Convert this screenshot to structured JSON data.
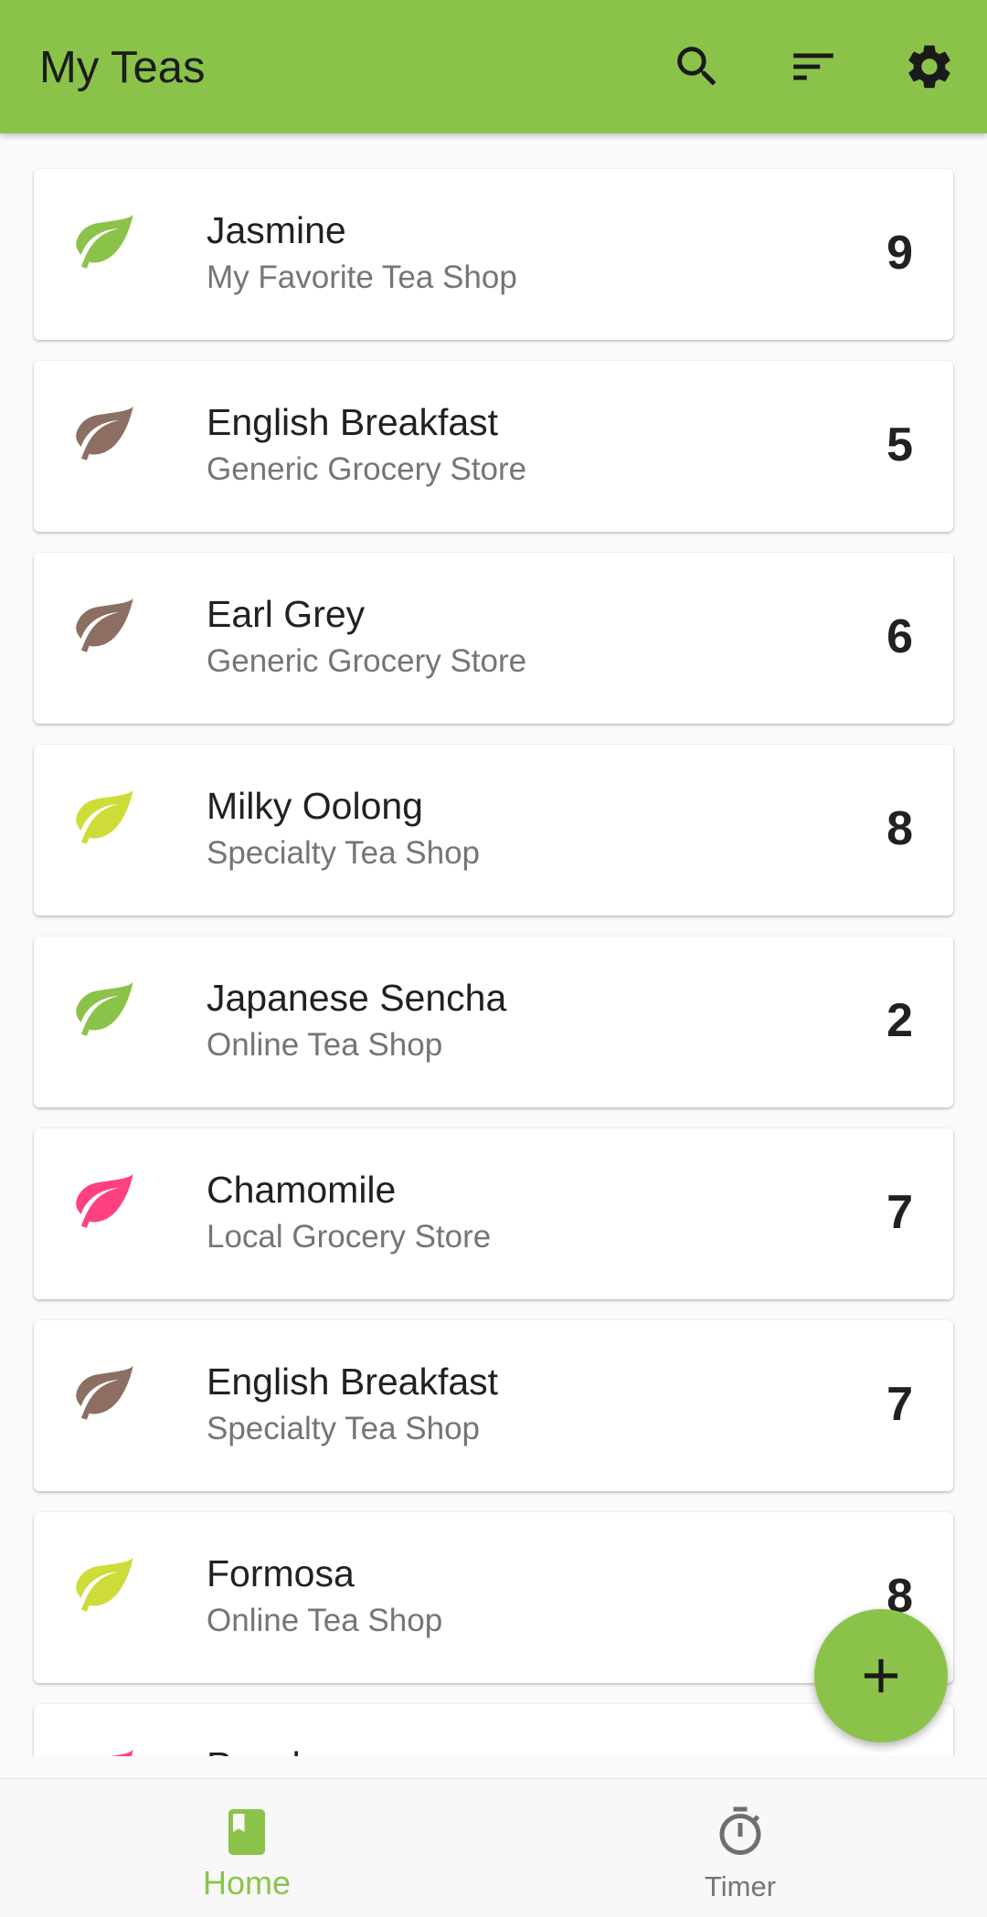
{
  "app": {
    "title": "My Teas",
    "accent_color": "#8bc34a"
  },
  "toolbar": {
    "search_icon": "search-icon",
    "sort_icon": "sort-icon",
    "settings_icon": "gear-icon"
  },
  "teas": [
    {
      "name": "Jasmine",
      "shop": "My Favorite Tea Shop",
      "rating": "9",
      "leaf_color": "#8bc34a"
    },
    {
      "name": "English Breakfast",
      "shop": "Generic Grocery Store",
      "rating": "5",
      "leaf_color": "#8d6e63"
    },
    {
      "name": "Earl Grey",
      "shop": "Generic Grocery Store",
      "rating": "6",
      "leaf_color": "#8d6e63"
    },
    {
      "name": "Milky Oolong",
      "shop": "Specialty Tea Shop",
      "rating": "8",
      "leaf_color": "#cddc39"
    },
    {
      "name": "Japanese Sencha",
      "shop": "Online Tea Shop",
      "rating": "2",
      "leaf_color": "#8bc34a"
    },
    {
      "name": "Chamomile",
      "shop": "Local Grocery Store",
      "rating": "7",
      "leaf_color": "#ff4081"
    },
    {
      "name": "English Breakfast",
      "shop": "Specialty Tea Shop",
      "rating": "7",
      "leaf_color": "#8d6e63"
    },
    {
      "name": "Formosa",
      "shop": "Online Tea Shop",
      "rating": "8",
      "leaf_color": "#cddc39"
    },
    {
      "name": "Peach",
      "shop": "",
      "rating": "",
      "leaf_color": "#ff4081"
    }
  ],
  "fab": {
    "icon": "plus-icon",
    "color": "#8bc34a"
  },
  "bottom_nav": {
    "home": {
      "label": "Home",
      "icon": "bookmark-book-icon",
      "active": true
    },
    "timer": {
      "label": "Timer",
      "icon": "stopwatch-icon",
      "active": false
    }
  }
}
